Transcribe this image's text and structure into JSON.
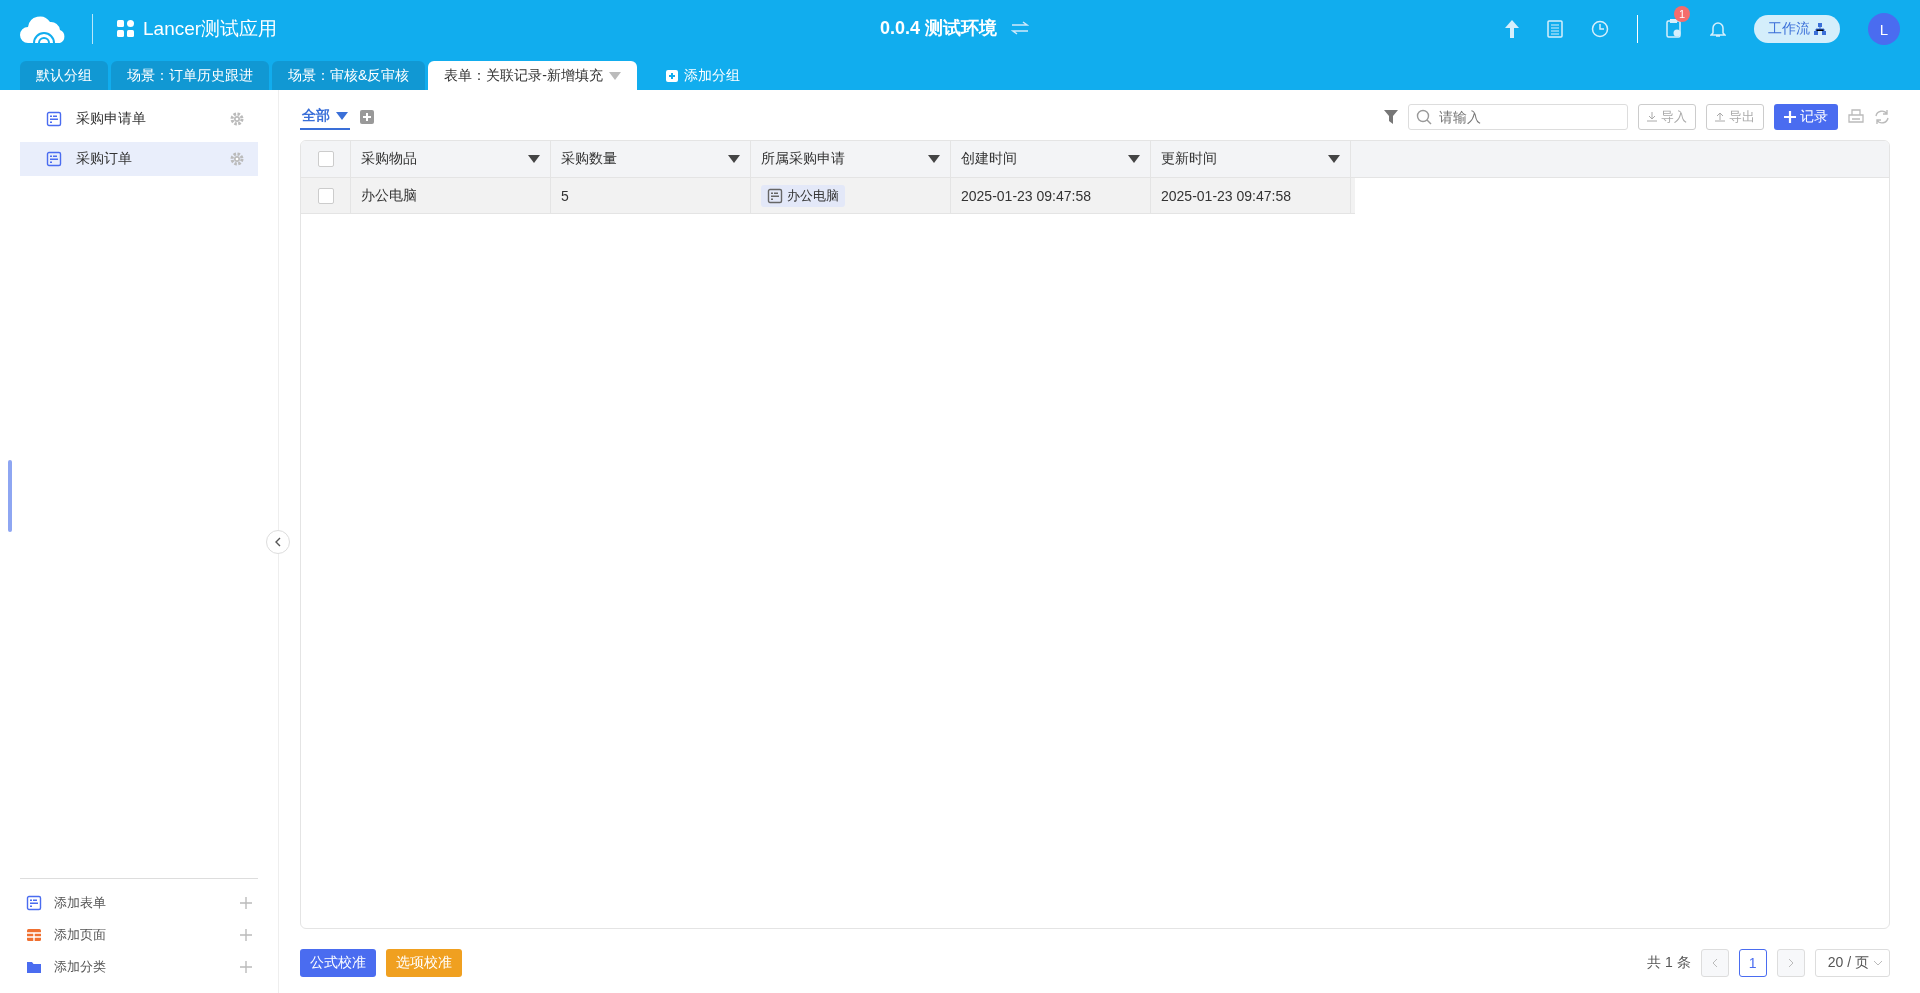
{
  "header": {
    "app_name": "Lancer测试应用",
    "env_title": "0.0.4 测试环境",
    "notification_badge": "1",
    "workflow_button": "工作流",
    "avatar_letter": "L"
  },
  "tabs": [
    {
      "label": "默认分组",
      "selected": false
    },
    {
      "label": "场景：订单历史跟进",
      "selected": false
    },
    {
      "label": "场景：审核&反审核",
      "selected": false
    },
    {
      "label": "表单：关联记录-新增填充",
      "selected": true
    }
  ],
  "add_group": "添加分组",
  "sidebar": {
    "items": [
      {
        "label": "采购申请单",
        "selected": false
      },
      {
        "label": "采购订单",
        "selected": true
      }
    ],
    "footer_items": [
      {
        "kind": "form",
        "label": "添加表单"
      },
      {
        "kind": "page",
        "label": "添加页面"
      },
      {
        "kind": "folder",
        "label": "添加分类"
      }
    ]
  },
  "view_tab": {
    "label": "全部",
    "selected": true
  },
  "toolbar": {
    "search_placeholder": "请输入",
    "import": "导入",
    "export": "导出",
    "add_record": "记录"
  },
  "table": {
    "select_all_checked": false,
    "columns": [
      "采购物品",
      "采购数量",
      "所属采购申请",
      "创建时间",
      "更新时间"
    ],
    "rows": [
      {
        "checked": false,
        "cells": [
          {
            "kind": "text",
            "text": "办公电脑"
          },
          {
            "kind": "text",
            "text": "5"
          },
          {
            "kind": "link",
            "text": "办公电脑"
          },
          {
            "kind": "text",
            "text": "2025-01-23 09:47:58"
          },
          {
            "kind": "text",
            "text": "2025-01-23 09:47:58"
          }
        ]
      }
    ]
  },
  "bottom_buttons": [
    {
      "kind": "primary",
      "label": "公式校准"
    },
    {
      "kind": "warning",
      "label": "选项校准"
    }
  ],
  "pagination": {
    "total": "共 1 条",
    "pages": [
      {
        "label": "1",
        "selected": true
      }
    ],
    "page_size": "20 / 页"
  }
}
